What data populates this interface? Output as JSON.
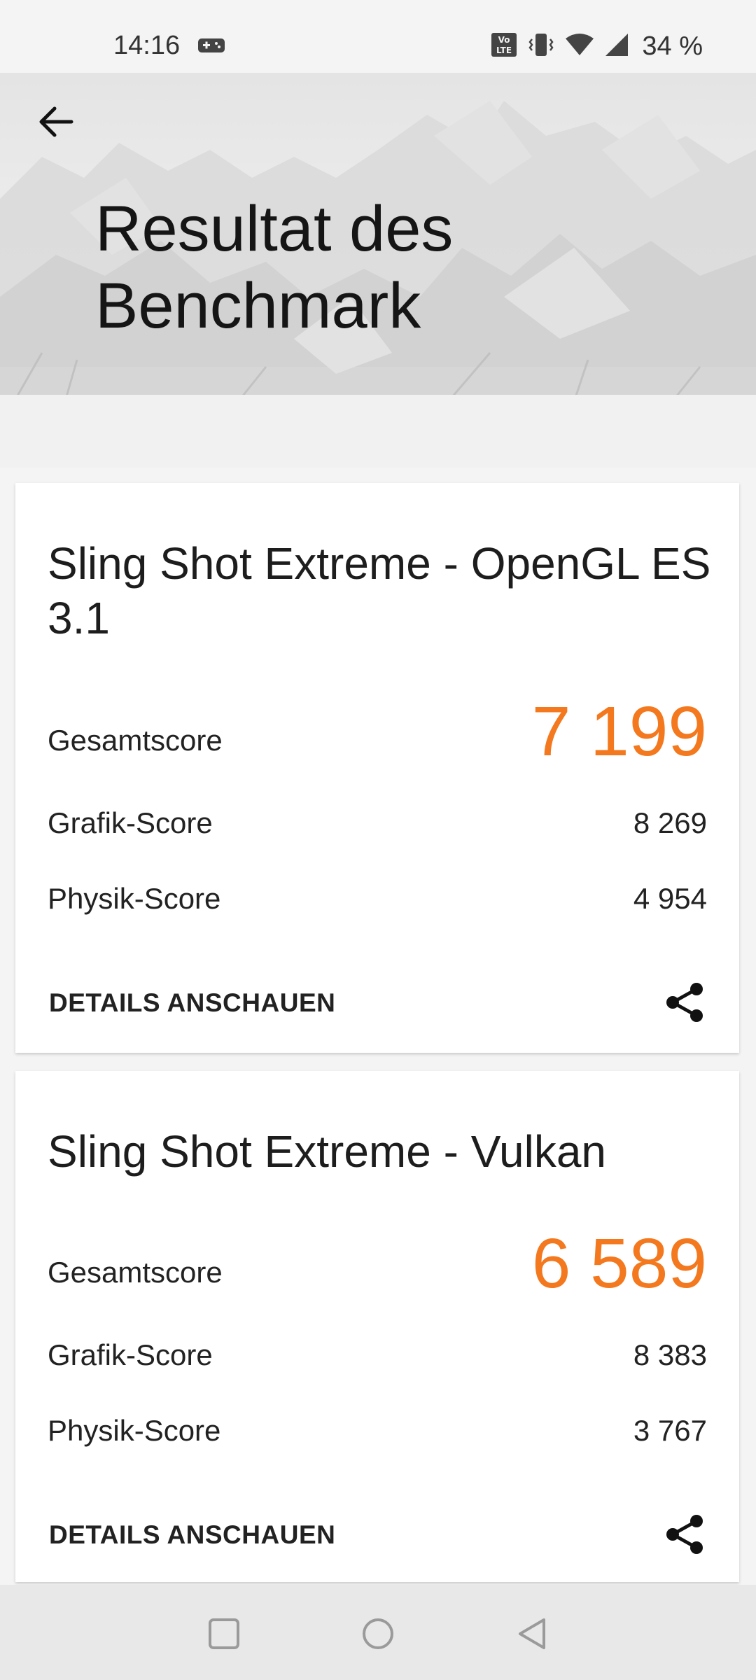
{
  "status_bar": {
    "time": "14:16",
    "battery": "34 %",
    "icons": [
      "gamepad-icon",
      "volte-icon",
      "vibrate-icon",
      "wifi-icon",
      "signal-icon"
    ]
  },
  "header": {
    "title_line1": "Resultat des",
    "title_line2": "Benchmark",
    "back_icon": "arrow-left-icon"
  },
  "results": [
    {
      "title": "Sling Shot Extreme - OpenGL ES 3.1",
      "total_label": "Gesamtscore",
      "total_value": "7 199",
      "graphics_label": "Grafik-Score",
      "graphics_value": "8 269",
      "physics_label": "Physik-Score",
      "physics_value": "4 954",
      "details_label": "DETAILS ANSCHAUEN",
      "share_icon": "share-icon"
    },
    {
      "title": "Sling Shot Extreme - Vulkan",
      "total_label": "Gesamtscore",
      "total_value": "6 589",
      "graphics_label": "Grafik-Score",
      "graphics_value": "8 383",
      "physics_label": "Physik-Score",
      "physics_value": "3 767",
      "details_label": "DETAILS ANSCHAUEN",
      "share_icon": "share-icon"
    }
  ],
  "colors": {
    "accent": "#f3781e",
    "background": "#f4f4f4",
    "card": "#ffffff"
  },
  "nav_bar": {
    "icons": [
      "recents-square-icon",
      "home-circle-icon",
      "back-triangle-icon"
    ]
  }
}
